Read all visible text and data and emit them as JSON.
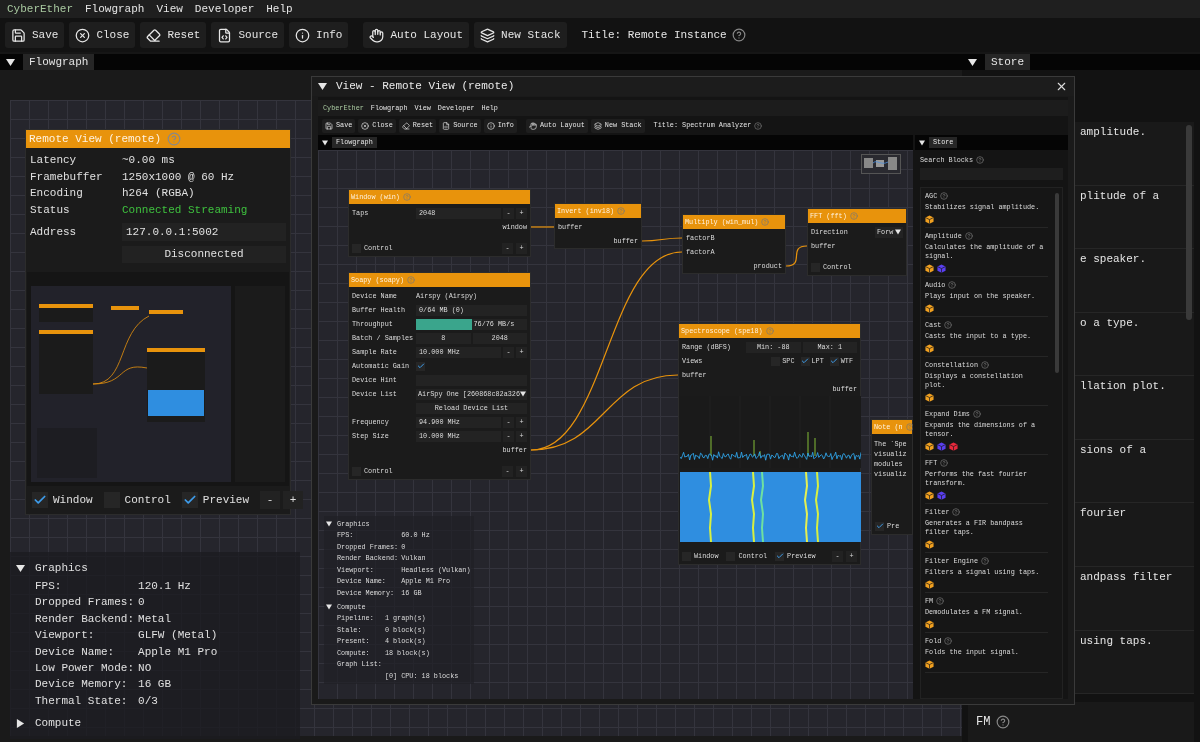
{
  "menu": [
    "CyberEther",
    "Flowgraph",
    "View",
    "Developer",
    "Help"
  ],
  "toolbar": {
    "buttons": [
      {
        "kind": "save",
        "label": "Save"
      },
      {
        "kind": "close",
        "label": "Close"
      },
      {
        "kind": "reset",
        "label": "Reset"
      },
      {
        "kind": "source",
        "label": "Source"
      },
      {
        "kind": "info",
        "label": "Info"
      },
      {
        "kind": "layout",
        "label": "Auto Layout"
      },
      {
        "kind": "stack",
        "label": "New Stack"
      }
    ],
    "title": "Title: Remote Instance"
  },
  "flowgraph_tab": "Flowgraph",
  "store_tab": "Store",
  "remote_node": {
    "title": "Remote View (remote)",
    "rows": [
      {
        "kind": "text",
        "label": "Latency",
        "value": "~0.00 ms"
      },
      {
        "kind": "text",
        "label": "Framebuffer",
        "value": "1250x1000 @ 60 Hz"
      },
      {
        "kind": "text",
        "label": "Encoding",
        "value": "h264 (RGBA)"
      },
      {
        "kind": "status",
        "label": "Status",
        "value": "Connected Streaming"
      }
    ],
    "address": {
      "label": "Address",
      "value": "127.0.0.1:5002"
    },
    "button": "Disconnected",
    "footer": {
      "checks": [
        {
          "label": "Window",
          "checked": true
        },
        {
          "label": "Control",
          "checked": false
        },
        {
          "label": "Preview",
          "checked": true
        }
      ],
      "stepper": [
        "-",
        "+"
      ]
    }
  },
  "stats": [
    {
      "title": "Graphics",
      "expanded": true,
      "rows": [
        {
          "label": "FPS:",
          "value": "120.1 Hz"
        },
        {
          "label": "Dropped Frames:",
          "value": "0"
        },
        {
          "label": "Render Backend:",
          "value": "Metal"
        },
        {
          "label": "Viewport:",
          "value": "GLFW (Metal)"
        },
        {
          "label": "Device Name:",
          "value": "Apple M1 Pro"
        },
        {
          "label": "Low Power Mode:",
          "value": "NO"
        },
        {
          "label": "Device Memory:",
          "value": "16 GB"
        },
        {
          "label": "Thermal State:",
          "value": "0/3"
        }
      ]
    },
    {
      "title": "Compute",
      "expanded": false
    }
  ],
  "store_background": {
    "lines": [
      "amplitude.",
      "plitude of a",
      "e speaker.",
      "o a type.",
      "llation plot.",
      "sions of a",
      "fourier",
      "andpass filter",
      "using taps."
    ],
    "last_item": "FM"
  },
  "remote_window": {
    "title": "View - Remote View (remote)",
    "menu": [
      "CyberEther",
      "Flowgraph",
      "View",
      "Developer",
      "Help"
    ],
    "toolbar": {
      "buttons": [
        {
          "kind": "save",
          "label": "Save"
        },
        {
          "kind": "close",
          "label": "Close"
        },
        {
          "kind": "reset",
          "label": "Reset"
        },
        {
          "kind": "source",
          "label": "Source"
        },
        {
          "kind": "info",
          "label": "Info"
        },
        {
          "kind": "layout",
          "label": "Auto Layout"
        },
        {
          "kind": "stack",
          "label": "New Stack"
        }
      ],
      "title": "Title: Spectrum Analyzer"
    },
    "flowgraph_tab": "Flowgraph",
    "store_tab": "Store",
    "nodes": [
      {
        "title": "Window (win)",
        "rows": [
          {
            "kind": "input",
            "label": "Taps",
            "value": "2048",
            "stepper": [
              "-",
              "+"
            ]
          },
          {
            "kind": "out",
            "label": "window"
          }
        ],
        "footer": {
          "checks": [
            {
              "label": "Control",
              "checked": false
            }
          ],
          "stepper": [
            "-",
            "+"
          ]
        }
      },
      {
        "title": "Invert (inv18)",
        "rows": [
          {
            "kind": "in",
            "label": "buffer"
          },
          {
            "kind": "out",
            "label": "buffer"
          }
        ]
      },
      {
        "title": "Multiply (win_mul)",
        "rows": [
          {
            "kind": "in",
            "label": "factorB"
          },
          {
            "kind": "in",
            "label": "factorA"
          },
          {
            "kind": "out",
            "label": "product"
          }
        ]
      },
      {
        "title": "FFT (fft)",
        "rows": [
          {
            "kind": "dropdown",
            "label": "Direction",
            "value": "Forw"
          },
          {
            "kind": "in",
            "label": "buffer"
          }
        ],
        "footer": {
          "checks": [
            {
              "label": "Control",
              "checked": false
            }
          ]
        }
      },
      {
        "title": "Soapy (soapy)",
        "rows": [
          {
            "kind": "value",
            "label": "Device Name",
            "value": "Airspy (Airspy)"
          },
          {
            "kind": "input",
            "label": "Buffer Health",
            "value": "0/64 MB (0)"
          },
          {
            "kind": "progress",
            "label": "Throughput",
            "level": 0.5,
            "reading": "76/76 MB/s"
          },
          {
            "kind": "pair",
            "label": "Batch / Samples",
            "values": [
              "8",
              "2048"
            ]
          },
          {
            "kind": "input",
            "label": "Sample Rate",
            "value": "10.000 MHz",
            "stepper": [
              "-",
              "+"
            ]
          },
          {
            "kind": "check",
            "label": "Automatic Gain",
            "checked": true
          },
          {
            "kind": "input",
            "label": "Device Hint"
          },
          {
            "kind": "dropdown",
            "label": "Device List",
            "value": "AirSpy One [260868c82a326"
          },
          {
            "kind": "button",
            "value": "Reload Device List"
          },
          {
            "kind": "input",
            "label": "Frequency",
            "value": "94.900 MHz",
            "stepper": [
              "-",
              "+"
            ]
          },
          {
            "kind": "input",
            "label": "Step Size",
            "value": "10.000 MHz",
            "stepper": [
              "-",
              "+"
            ]
          },
          {
            "kind": "out",
            "label": "buffer"
          }
        ],
        "footer": {
          "checks": [
            {
              "label": "Control",
              "checked": false
            }
          ],
          "stepper": [
            "-",
            "+"
          ]
        }
      },
      {
        "title": "Spectroscope (spe18)",
        "rows": [
          {
            "kind": "pair",
            "label": "Range (dBFS)",
            "values": [
              "Min: -88",
              "Max: 1"
            ]
          },
          {
            "kind": "views",
            "label": "Views",
            "checks": [
              {
                "label": "SPC",
                "checked": false
              },
              {
                "label": "LPT",
                "checked": true
              },
              {
                "label": "WTF",
                "checked": true
              }
            ]
          },
          {
            "kind": "in",
            "label": "buffer"
          },
          {
            "kind": "out",
            "label": "buffer"
          },
          {
            "kind": "spectrum"
          },
          {
            "kind": "waterfall"
          }
        ],
        "footer": {
          "checks": [
            {
              "label": "Window",
              "checked": false
            },
            {
              "label": "Control",
              "checked": false
            },
            {
              "label": "Preview",
              "checked": true
            }
          ],
          "stepper": [
            "-",
            "+"
          ]
        }
      },
      {
        "title": "Note (n",
        "rows": [
          {
            "kind": "note",
            "lines": [
              "The `Spe",
              "visualiz",
              "modules",
              "visualiz"
            ]
          }
        ],
        "footer": {
          "checks": [
            {
              "label": "Pre",
              "checked": true
            }
          ]
        }
      }
    ],
    "stats": [
      {
        "title": "Graphics",
        "expanded": true,
        "rows": [
          {
            "label": "FPS:",
            "value": "60.0 Hz"
          },
          {
            "label": "Dropped Frames:",
            "value": "0"
          },
          {
            "label": "Render Backend:",
            "value": "Vulkan"
          },
          {
            "label": "Viewport:",
            "value": "Headless (Vulkan)"
          },
          {
            "label": "Device Name:",
            "value": "Apple M1 Pro"
          },
          {
            "label": "Device Memory:",
            "value": "16 GB"
          }
        ]
      },
      {
        "title": "Compute",
        "expanded": true,
        "rows": [
          {
            "label": "Pipeline:",
            "value": "1 graph(s)"
          },
          {
            "label": "Stale:",
            "value": "0 block(s)"
          },
          {
            "label": "Present:",
            "value": "4 block(s)"
          },
          {
            "label": "Compute:",
            "value": "18 block(s)"
          },
          {
            "label": "Graph List:"
          },
          {
            "value": "[0] CPU: 18 blocks"
          }
        ]
      }
    ],
    "store": {
      "search_label": "Search Blocks",
      "items": [
        {
          "name": "AGC",
          "description": "Stabilizes signal amplitude.",
          "tags": [
            {
              "color": "#f0a020"
            }
          ]
        },
        {
          "name": "Amplitude",
          "description": "Calculates the amplitude of a signal.",
          "tags": [
            {
              "color": "#f0a020"
            },
            {
              "color": "#5a3ff0"
            }
          ]
        },
        {
          "name": "Audio",
          "description": "Plays input on the speaker.",
          "tags": [
            {
              "color": "#f0a020"
            }
          ]
        },
        {
          "name": "Cast",
          "description": "Casts the input to a type.",
          "tags": [
            {
              "color": "#f0a020"
            }
          ]
        },
        {
          "name": "Constellation",
          "description": "Displays a constellation plot.",
          "tags": [
            {
              "color": "#f0a020"
            }
          ]
        },
        {
          "name": "Expand Dims",
          "description": "Expands the dimensions of a tensor.",
          "tags": [
            {
              "color": "#f0a020"
            },
            {
              "color": "#5a3ff0"
            },
            {
              "color": "#e8283c"
            }
          ]
        },
        {
          "name": "FFT",
          "description": "Performs the fast fourier transform.",
          "tags": [
            {
              "color": "#f0a020"
            },
            {
              "color": "#5a3ff0"
            }
          ]
        },
        {
          "name": "Filter",
          "description": "Generates a FIR bandpass filter taps.",
          "tags": [
            {
              "color": "#f0a020"
            }
          ]
        },
        {
          "name": "Filter Engine",
          "description": "Filters a signal using taps.",
          "tags": [
            {
              "color": "#f0a020"
            }
          ]
        },
        {
          "name": "FM",
          "description": "Demodulates a FM signal.",
          "tags": [
            {
              "color": "#f0a020"
            }
          ]
        },
        {
          "name": "Fold",
          "description": "Folds the input signal.",
          "tags": [
            {
              "color": "#f0a020"
            }
          ]
        }
      ]
    }
  }
}
